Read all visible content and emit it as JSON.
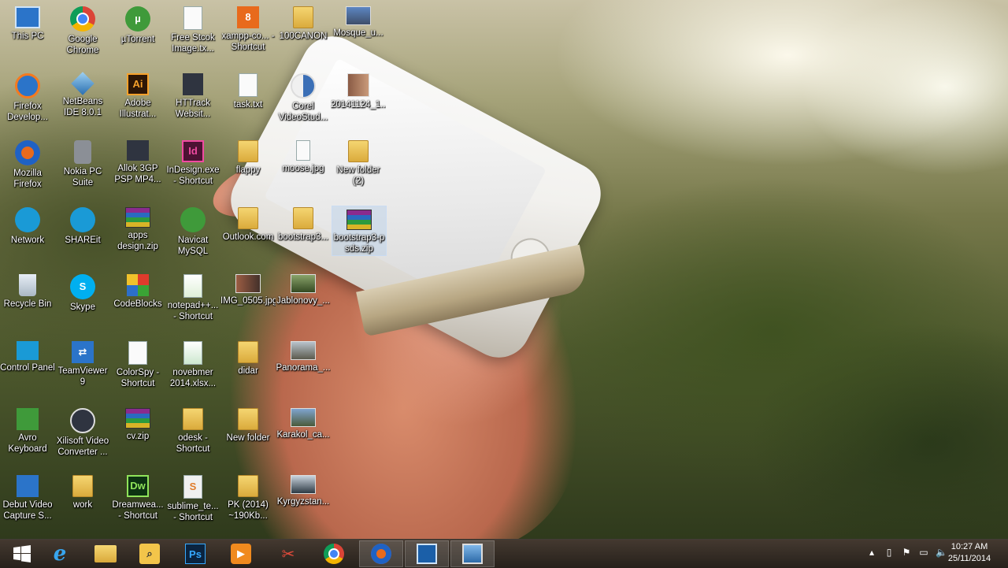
{
  "desktop": {
    "icons": [
      {
        "label": "This PC"
      },
      {
        "label": "Google Chrome"
      },
      {
        "label": "µTorrent"
      },
      {
        "label": "Free Stcok Image.tx..."
      },
      {
        "label": "xampp-co... - Shortcut"
      },
      {
        "label": "100CANON"
      },
      {
        "label": "Mosque_u..."
      },
      {
        "label": "Firefox Develop..."
      },
      {
        "label": "NetBeans IDE 8.0.1"
      },
      {
        "label": "Adobe Illustrat..."
      },
      {
        "label": "HTTrack Websit..."
      },
      {
        "label": "task.txt"
      },
      {
        "label": "Corel VideoStud..."
      },
      {
        "label": "20141124_1..."
      },
      {
        "label": "Mozilla Firefox"
      },
      {
        "label": "Nokia PC Suite"
      },
      {
        "label": "Allok 3GP PSP MP4..."
      },
      {
        "label": "InDesign.exe - Shortcut"
      },
      {
        "label": "flappy"
      },
      {
        "label": "moose.jpg"
      },
      {
        "label": "New folder (2)"
      },
      {
        "label": "Network"
      },
      {
        "label": "SHAREit"
      },
      {
        "label": "apps design.zip"
      },
      {
        "label": "Navicat MySQL"
      },
      {
        "label": "Outlook.com"
      },
      {
        "label": "bootstrap3..."
      },
      {
        "label": "bootstrap3-p sds.zip"
      },
      {
        "label": "Recycle Bin"
      },
      {
        "label": "Skype"
      },
      {
        "label": "CodeBlocks"
      },
      {
        "label": "notepad++... - Shortcut"
      },
      {
        "label": "IMG_0505.jpg"
      },
      {
        "label": "Jablonovy_..."
      },
      {
        "label": "Control Panel"
      },
      {
        "label": "TeamViewer 9"
      },
      {
        "label": "ColorSpy - Shortcut"
      },
      {
        "label": "novebmer 2014.xlsx..."
      },
      {
        "label": "didar"
      },
      {
        "label": "Panorama_..."
      },
      {
        "label": "Avro Keyboard"
      },
      {
        "label": "Xilisoft Video Converter ..."
      },
      {
        "label": "cv.zip"
      },
      {
        "label": "odesk - Shortcut"
      },
      {
        "label": "New folder"
      },
      {
        "label": "Karakol_ca..."
      },
      {
        "label": "Debut Video Capture S..."
      },
      {
        "label": "work"
      },
      {
        "label": "Dreamwea... - Shortcut"
      },
      {
        "label": "sublime_te... - Shortcut"
      },
      {
        "label": "PK (2014) ~190Kb..."
      },
      {
        "label": "Kyrgyzstan..."
      }
    ]
  },
  "taskbar": {
    "items": [
      {
        "icon": "windows-start-icon"
      },
      {
        "icon": "internet-explorer-icon"
      },
      {
        "icon": "file-explorer-icon"
      },
      {
        "icon": "search-magnifier-icon"
      },
      {
        "icon": "photoshop-icon",
        "text": "Ps"
      },
      {
        "icon": "media-player-icon"
      },
      {
        "icon": "snipping-tool-icon"
      },
      {
        "icon": "chrome-icon"
      },
      {
        "icon": "firefox-icon"
      },
      {
        "icon": "video-capture-icon"
      },
      {
        "icon": "image-viewer-icon"
      }
    ],
    "clock": {
      "time": "10:27 AM",
      "date": "25/11/2014"
    }
  },
  "colors": {
    "taskbar": "#2a2018",
    "selection": "#aac8eb"
  }
}
